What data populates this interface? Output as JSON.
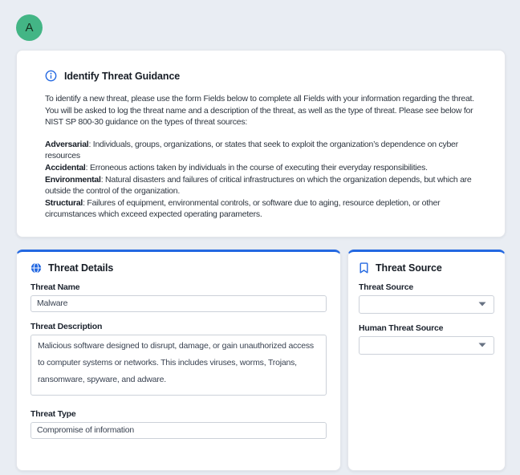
{
  "accent_color": "#2368e1",
  "avatar": {
    "initial": "A",
    "bg_color": "#43b585"
  },
  "guidance_card": {
    "title": "Identify Threat Guidance",
    "intro": "To identify a new threat, please use the form Fields below to complete all Fields with your information regarding the threat. You will be asked to log the threat name and a description of the threat, as well as the type of threat. Please see below for NIST SP 800-30 guidance on the types of threat sources:",
    "sources": [
      {
        "term": "Adversarial",
        "desc": ": Individuals, groups, organizations, or states that seek to exploit the organization’s dependence on cyber resources"
      },
      {
        "term": "Accidental",
        "desc": ": Erroneous actions taken by individuals in the course of executing their everyday responsibilities."
      },
      {
        "term": "Environmental",
        "desc": ": Natural disasters and failures of critical infrastructures on which the organization depends, but which are outside the control of the organization."
      },
      {
        "term": "Structural",
        "desc": ": Failures of equipment, environmental controls, or software due to aging, resource depletion, or other circumstances which exceed expected operating parameters."
      }
    ]
  },
  "details_card": {
    "title": "Threat Details",
    "fields": {
      "name": {
        "label": "Threat Name",
        "value": "Malware"
      },
      "description": {
        "label": "Threat Description",
        "value": "Malicious software designed to disrupt, damage, or gain unauthorized access to computer systems or networks. This includes viruses, worms, Trojans, ransomware, spyware, and adware."
      },
      "type": {
        "label": "Threat Type",
        "value": "Compromise of information"
      }
    }
  },
  "source_card": {
    "title": "Threat Source",
    "fields": {
      "threat_source": {
        "label": "Threat Source",
        "value": ""
      },
      "human_threat_source": {
        "label": "Human Threat Source",
        "value": ""
      }
    }
  }
}
